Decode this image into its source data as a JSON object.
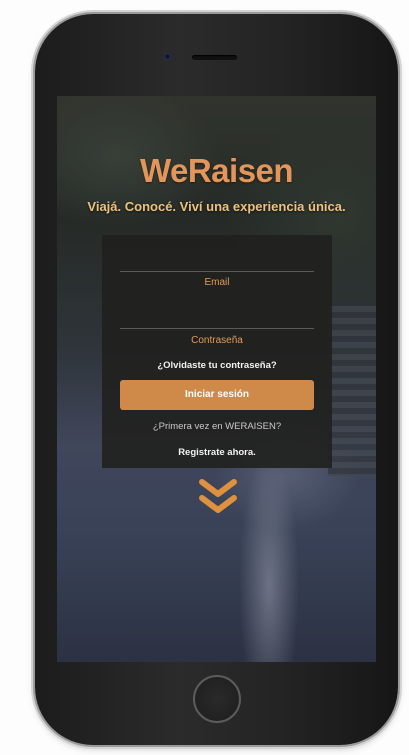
{
  "brand": {
    "logo_text": "WeRaisen",
    "tagline": "Viajá. Conocé. Viví una experiencia única.",
    "accent_color": "#d48d4c"
  },
  "login_form": {
    "email_label": "Email",
    "password_label": "Contraseña",
    "forgot_password_link": "¿Olvidaste tu contraseña?",
    "login_button": "Iniciar sesión",
    "first_time_text": "¿Primera vez en WERAISEN?",
    "register_link": "Registrate ahora."
  },
  "icons": {
    "scroll": "double-chevron-down-icon",
    "device_home": "home-button",
    "device_camera": "front-camera",
    "device_speaker": "earpiece-speaker"
  }
}
